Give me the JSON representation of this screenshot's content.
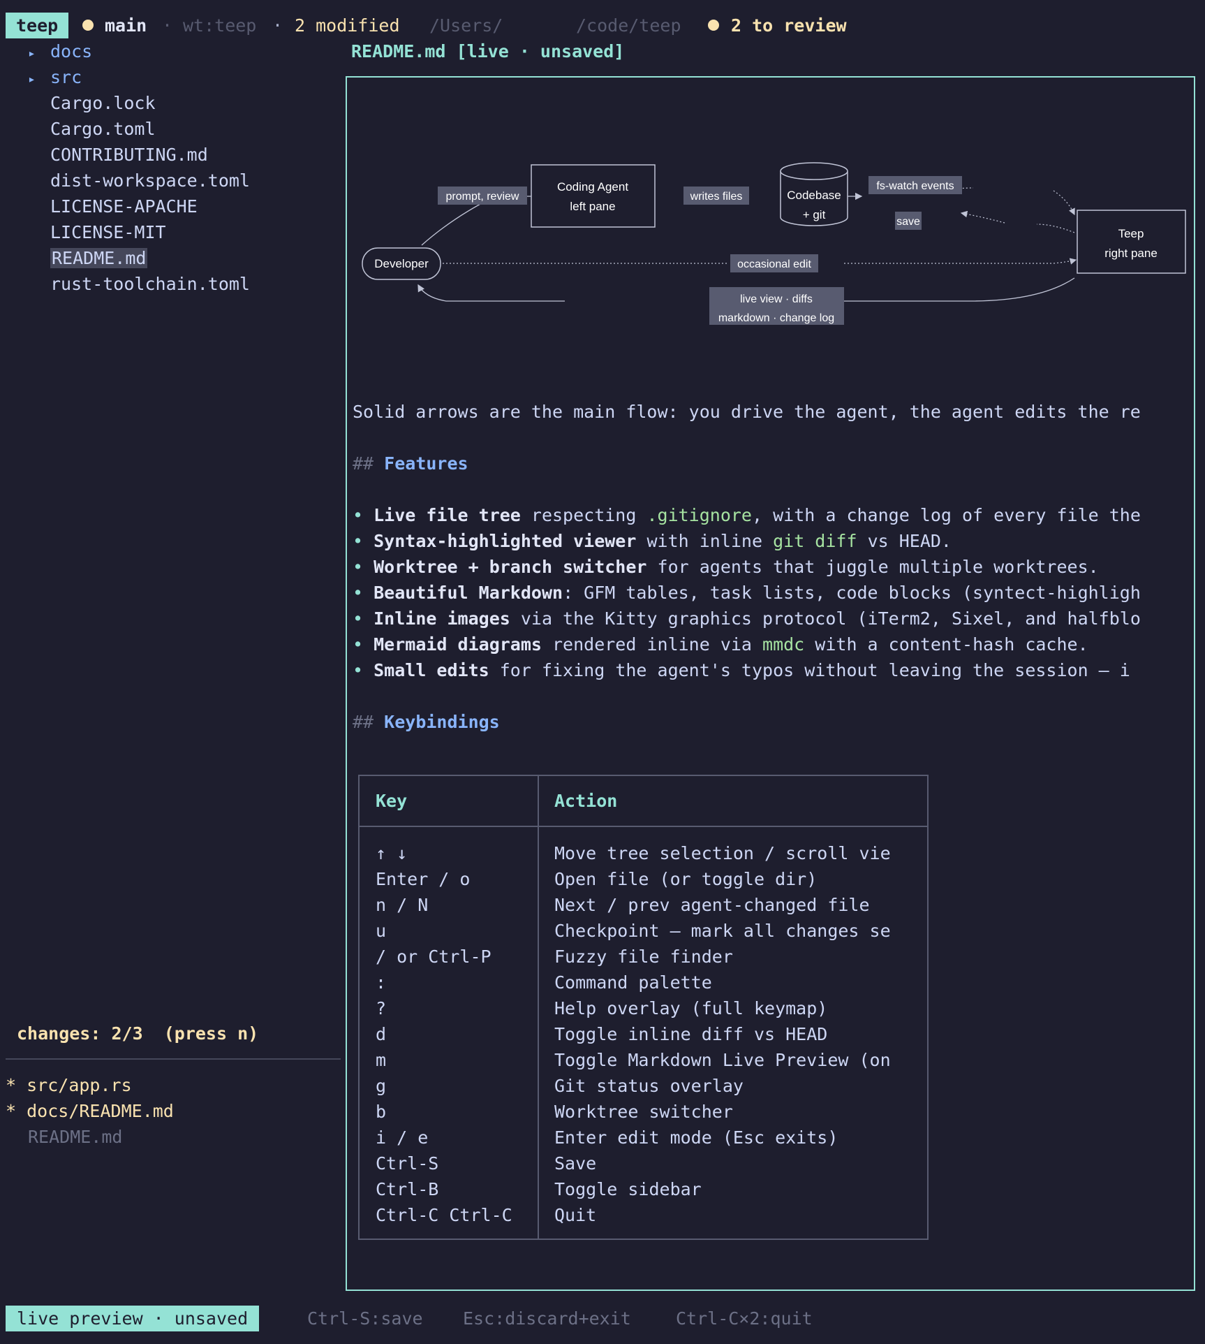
{
  "topbar": {
    "app_name": "teep",
    "branch": "main",
    "separator": "·",
    "worktree": "wt:teep",
    "modified": "2 modified",
    "path_prefix": "/Users/",
    "path_suffix": "/code/teep",
    "review": "2 to review"
  },
  "tree": [
    {
      "label": "docs",
      "type": "dir"
    },
    {
      "label": "src",
      "type": "dir"
    },
    {
      "label": "Cargo.lock",
      "type": "file"
    },
    {
      "label": "Cargo.toml",
      "type": "file"
    },
    {
      "label": "CONTRIBUTING.md",
      "type": "file"
    },
    {
      "label": "dist-workspace.toml",
      "type": "file"
    },
    {
      "label": "LICENSE-APACHE",
      "type": "file"
    },
    {
      "label": "LICENSE-MIT",
      "type": "file"
    },
    {
      "label": "README.md",
      "type": "file",
      "selected": true
    },
    {
      "label": "rust-toolchain.toml",
      "type": "file"
    }
  ],
  "changes": {
    "header": "changes: 2/3  (press n)",
    "items": [
      {
        "marker": "*",
        "label": "src/app.rs",
        "state": "modified"
      },
      {
        "marker": "*",
        "label": "docs/README.md",
        "state": "modified"
      },
      {
        "marker": "",
        "label": "README.md",
        "state": "done"
      }
    ]
  },
  "viewer": {
    "title": "README.md [live · unsaved]",
    "diagram": {
      "prompt_label": "prompt, review",
      "agent_title": "Coding Agent",
      "agent_sub": "left pane",
      "writes_label": "writes files",
      "codebase_title": "Codebase",
      "codebase_sub": "+ git",
      "fswatch_label": "fs-watch events",
      "save_label": "save",
      "teep_title": "Teep",
      "teep_sub": "right pane",
      "developer": "Developer",
      "edit_label": "occasional edit",
      "live_line1": "live view · diffs",
      "live_line2": "markdown · change log"
    },
    "intro": "Solid arrows are the main flow: you drive the agent, the agent edits the re",
    "features_hash": "##",
    "features_title": "Features",
    "bullet_char": "•",
    "f1_bold": "Live file tree",
    "f1_a": " respecting ",
    "f1_code": ".gitignore",
    "f1_b": ", with a change log of every file the",
    "f2_bold": "Syntax-highlighted viewer",
    "f2_a": " with inline ",
    "f2_code": "git diff",
    "f2_b": " vs HEAD.",
    "f3_bold": "Worktree + branch switcher",
    "f3_a": " for agents that juggle multiple worktrees.",
    "f4_bold": "Beautiful Markdown",
    "f4_a": ": GFM tables, task lists, code blocks (syntect-highligh",
    "f5_bold": "Inline images",
    "f5_a": " via the Kitty graphics protocol (iTerm2, Sixel, and halfblo",
    "f6_bold": "Mermaid diagrams",
    "f6_a": " rendered inline via ",
    "f6_code": "mmdc",
    "f6_b": " with a content-hash cache.",
    "f7_bold": "Small edits",
    "f7_a": " for fixing the agent's typos without leaving the session — i",
    "keys_hash": "##",
    "keys_title": "Keybindings",
    "table_headers": {
      "key": "Key",
      "action": "Action"
    },
    "keys": [
      {
        "key": "↑ ↓",
        "action": "Move tree selection / scroll vie"
      },
      {
        "key": "Enter / o",
        "action": "Open file (or toggle dir)"
      },
      {
        "key": "n / N",
        "action": "Next / prev agent-changed file"
      },
      {
        "key": "u",
        "action": "Checkpoint — mark all changes se"
      },
      {
        "key": "/ or Ctrl-P",
        "action": "Fuzzy file finder"
      },
      {
        "key": ":",
        "action": "Command palette"
      },
      {
        "key": "?",
        "action": "Help overlay (full keymap)"
      },
      {
        "key": "d",
        "action": "Toggle inline diff vs HEAD"
      },
      {
        "key": "m",
        "action": "Toggle Markdown Live Preview (on"
      },
      {
        "key": "g",
        "action": "Git status overlay"
      },
      {
        "key": "b",
        "action": "Worktree switcher"
      },
      {
        "key": "i / e",
        "action": "Enter edit mode (Esc exits)"
      },
      {
        "key": "Ctrl-S",
        "action": "Save"
      },
      {
        "key": "Ctrl-B",
        "action": "Toggle sidebar"
      },
      {
        "key": "Ctrl-C Ctrl-C",
        "action": "Quit"
      }
    ]
  },
  "statusbar": {
    "mode": "live preview · unsaved",
    "hint_save": "Ctrl-S:save",
    "hint_discard": "Esc:discard+exit",
    "hint_quit": "Ctrl-C×2:quit"
  },
  "colors": {
    "background": "#1e1e2e",
    "accent_teal": "#94e2d5",
    "accent_yellow": "#f9e2af",
    "accent_blue": "#89b4fa",
    "code_green": "#a6e3a1"
  }
}
